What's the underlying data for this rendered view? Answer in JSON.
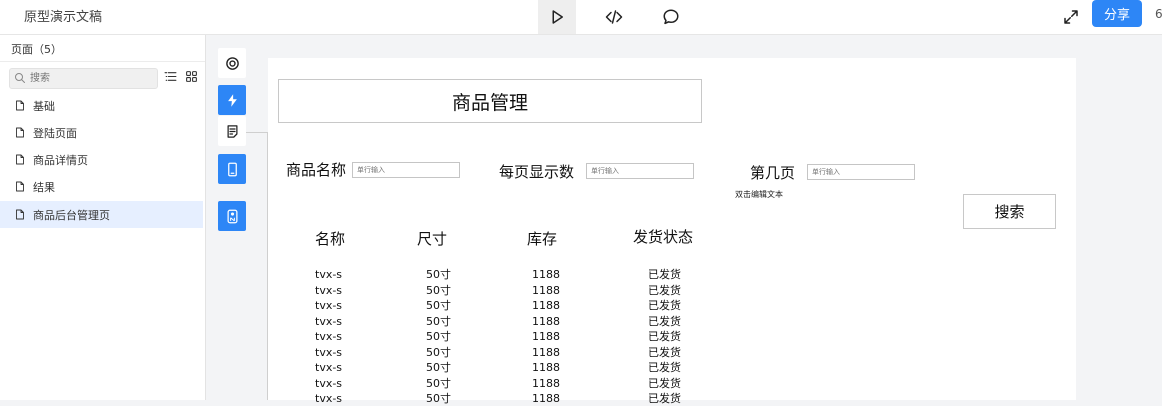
{
  "topbar": {
    "title": "原型演示文稿",
    "share_label": "分享",
    "right_digit": "6"
  },
  "sidebar": {
    "header": "页面（5）",
    "search_placeholder": "搜索",
    "pages": [
      {
        "label": "基础",
        "active": false
      },
      {
        "label": "登陆页面",
        "active": false
      },
      {
        "label": "商品详情页",
        "active": false
      },
      {
        "label": "结果",
        "active": false
      },
      {
        "label": "商品后台管理页",
        "active": true
      }
    ]
  },
  "artboard": {
    "title": "商品管理",
    "fields": [
      {
        "label": "商品名称",
        "placeholder": "单行输入"
      },
      {
        "label": "每页显示数",
        "placeholder": "单行输入"
      },
      {
        "label": "第几页",
        "placeholder": "单行输入"
      }
    ],
    "double_click_text": "双击编辑文本",
    "search_button": "搜索",
    "table": {
      "headers": [
        "名称",
        "尺寸",
        "库存",
        "发货状态"
      ],
      "rows": [
        [
          "tvx-s",
          "50寸",
          "1188",
          "已发货"
        ],
        [
          "tvx-s",
          "50寸",
          "1188",
          "已发货"
        ],
        [
          "tvx-s",
          "50寸",
          "1188",
          "已发货"
        ],
        [
          "tvx-s",
          "50寸",
          "1188",
          "已发货"
        ],
        [
          "tvx-s",
          "50寸",
          "1188",
          "已发货"
        ],
        [
          "tvx-s",
          "50寸",
          "1188",
          "已发货"
        ],
        [
          "tvx-s",
          "50寸",
          "1188",
          "已发货"
        ],
        [
          "tvx-s",
          "50寸",
          "1188",
          "已发货"
        ],
        [
          "tvx-s",
          "50寸",
          "1188",
          "已发货"
        ]
      ]
    }
  },
  "icons": {
    "play": "play-icon",
    "code": "code-icon",
    "comment": "comment-icon",
    "fullscreen": "fullscreen-icon",
    "search": "search-icon",
    "list_view": "list-view-icon",
    "grid_view": "grid-view-icon",
    "page": "page-icon",
    "target": "target-icon",
    "lightning": "lightning-icon",
    "note": "note-icon",
    "phone": "phone-icon",
    "toggle": "toggle-icon"
  },
  "colors": {
    "accent": "#2d86f6",
    "active_page_bg": "#e6efff"
  }
}
